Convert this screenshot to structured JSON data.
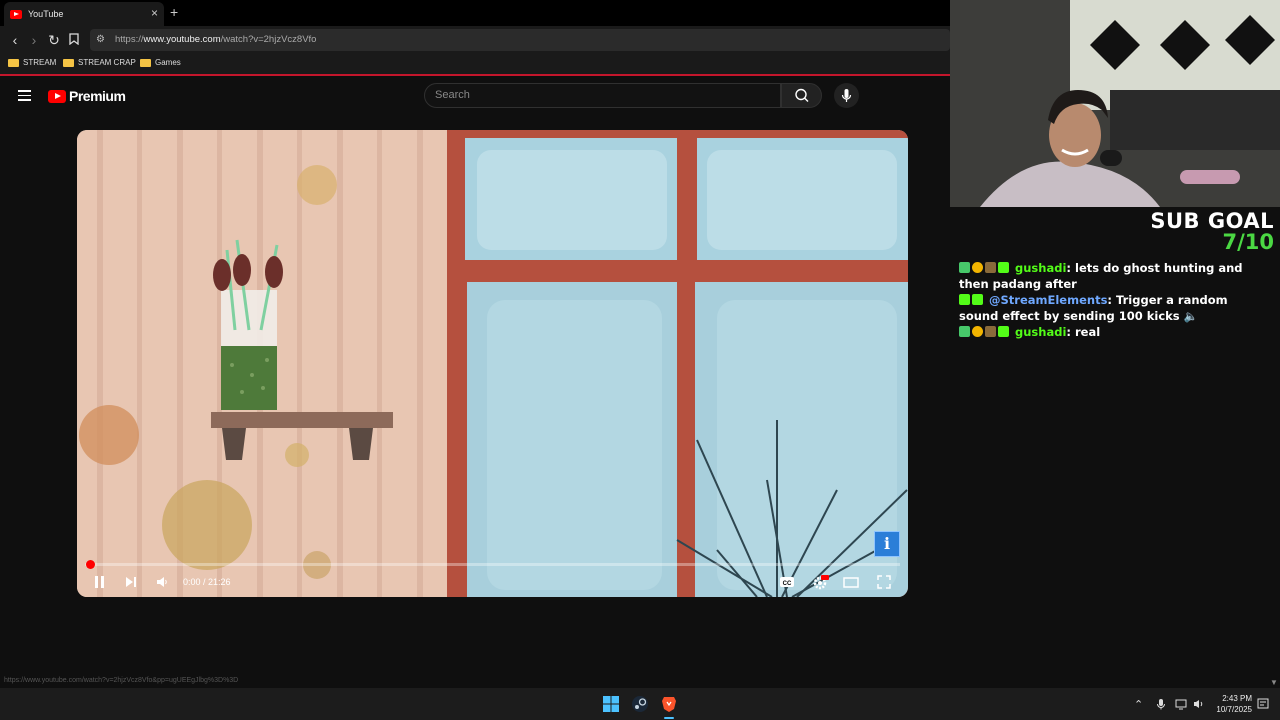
{
  "browser": {
    "tab_title": "YouTube",
    "url_host": "www.youtube.com",
    "url_prefix": "https://",
    "url_path": "/watch?v=2hjzVcz8Vfo",
    "bookmarks": [
      "STREAM",
      "STREAM CRAP",
      "Games"
    ],
    "status_url": "https://www.youtube.com/watch?v=2hjzVcz8Vfo&pp=ugUEEgJlbg%3D%3D"
  },
  "youtube": {
    "logo_text": "Premium",
    "search_placeholder": "Search"
  },
  "player": {
    "timecode": "0:00 / 21:26",
    "progress_fraction": 0.0,
    "info_badge": "i",
    "colors": {
      "progress": "#ff0000"
    }
  },
  "overlay": {
    "sub_goal_label": "SUB GOAL",
    "sub_goal_value": "7/10",
    "chat": [
      {
        "user": "gushadi",
        "text": "lets do ghost hunting and then padang after",
        "user_color": "#53fc18"
      },
      {
        "user": "@StreamElements",
        "text": "Trigger a random sound effect by sending 100 kicks 🔈",
        "user_color": "#6fa8ff"
      },
      {
        "user": "gushadi",
        "text": "real",
        "user_color": "#53fc18"
      }
    ]
  },
  "taskbar": {
    "time": "2:43 PM",
    "date": "10/7/2025"
  }
}
